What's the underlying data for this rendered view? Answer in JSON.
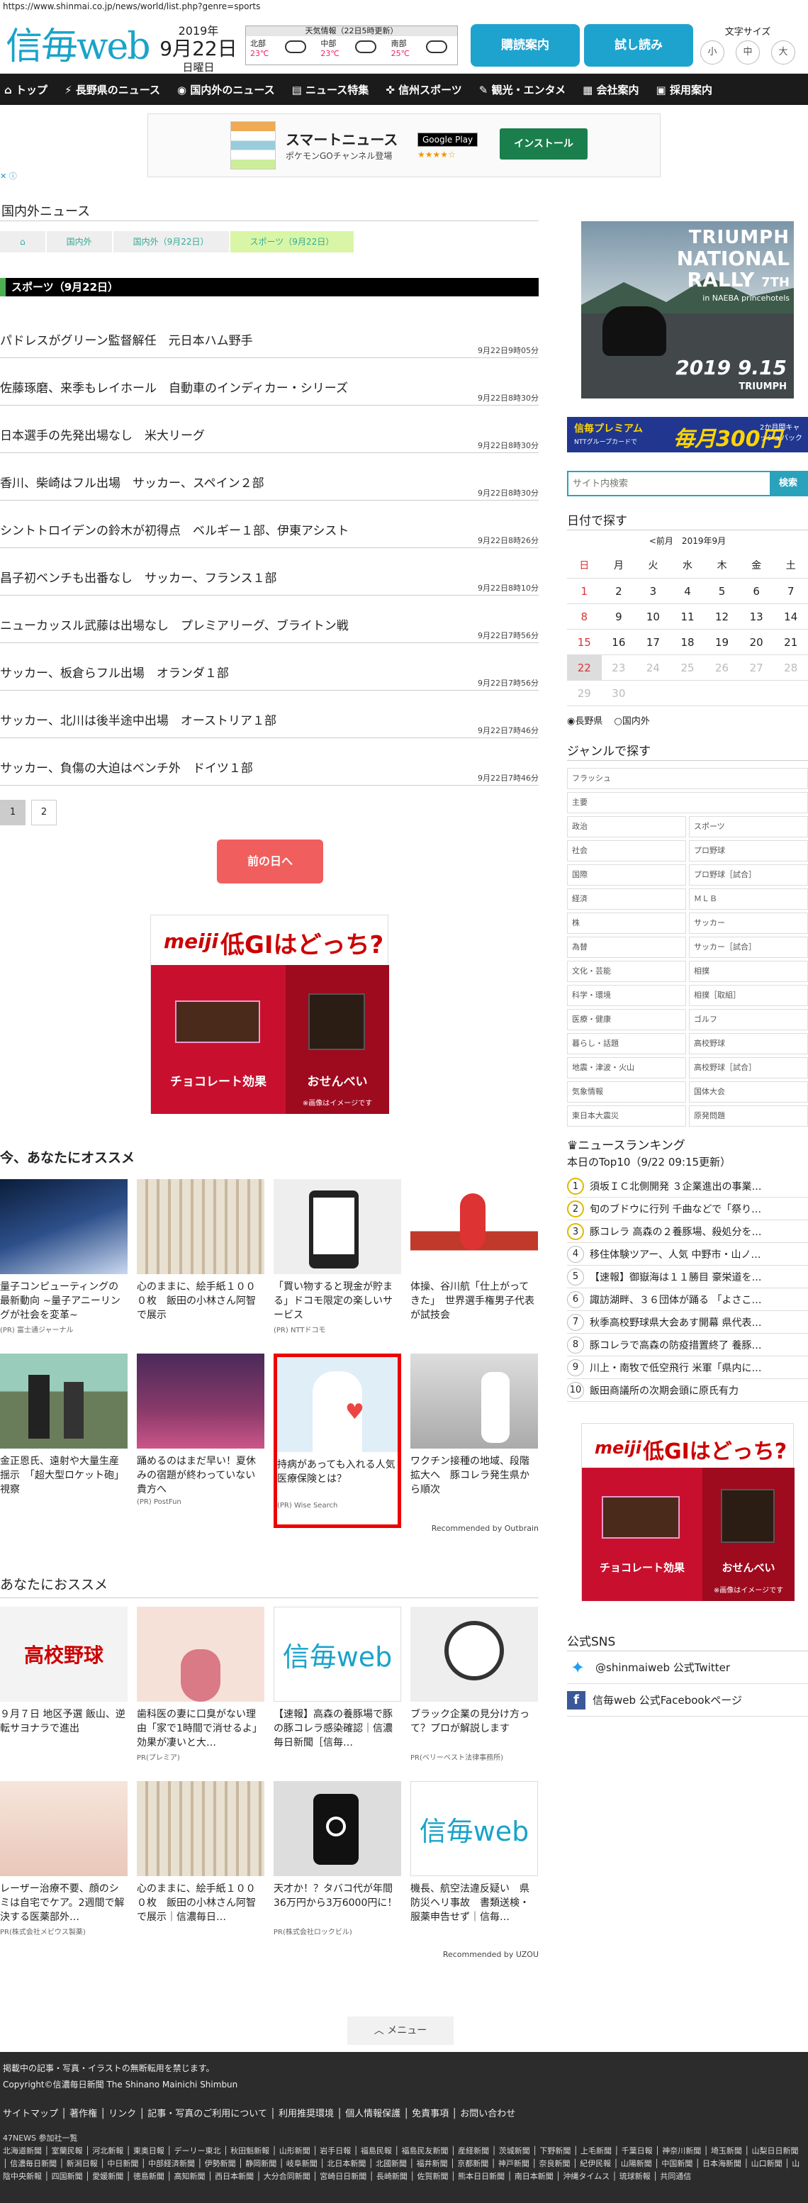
{
  "browser": {
    "url": "https://www.shinmai.co.jp/news/world/list.php?genre=sports"
  },
  "header": {
    "logo": "信毎web",
    "year": "2019年",
    "date": "9月22日",
    "weekday": "日曜日",
    "weather_title": "天気情報（22日5時更新）",
    "weather": [
      {
        "region": "北部",
        "temp": "23℃"
      },
      {
        "region": "中部",
        "temp": "23℃"
      },
      {
        "region": "南部",
        "temp": "25℃"
      }
    ],
    "btn_delivery": "購読案内",
    "btn_trial": "試し読み",
    "font_size_label": "文字サイズ",
    "font_sizes": [
      "小",
      "中",
      "大"
    ]
  },
  "nav": [
    "トップ",
    "長野県のニュース",
    "国内外のニュース",
    "ニュース特集",
    "信州スポーツ",
    "観光・エンタメ",
    "会社案内",
    "採用案内"
  ],
  "top_ad": {
    "name": "スマートニュース",
    "sub": "ポケモンGOチャンネル登場",
    "store": "Google Play",
    "stars": "★★★★☆",
    "cta": "インストール",
    "mark": "✕ ⓘ"
  },
  "main": {
    "section": "国内外ニュース",
    "breadcrumb": [
      "国内外",
      "国内外（9月22日）",
      "スポーツ（9月22日）"
    ],
    "list_title": "スポーツ（9月22日）",
    "news": [
      {
        "title": "パドレスがグリーン監督解任　元日本ハム野手",
        "date": "9月22日9時05分"
      },
      {
        "title": "佐藤琢磨、来季もレイホール　自動車のインディカー・シリーズ",
        "date": "9月22日8時30分"
      },
      {
        "title": "日本選手の先発出場なし　米大リーグ",
        "date": "9月22日8時30分"
      },
      {
        "title": "香川、柴崎はフル出場　サッカー、スペイン２部",
        "date": "9月22日8時30分"
      },
      {
        "title": "シントトロイデンの鈴木が初得点　ベルギー１部、伊東アシスト",
        "date": "9月22日8時26分"
      },
      {
        "title": "昌子初ベンチも出番なし　サッカー、フランス１部",
        "date": "9月22日8時10分"
      },
      {
        "title": "ニューカッスル武藤は出場なし　プレミアリーグ、ブライトン戦",
        "date": "9月22日7時56分"
      },
      {
        "title": "サッカー、板倉らフル出場　オランダ１部",
        "date": "9月22日7時56分"
      },
      {
        "title": "サッカー、北川は後半途中出場　オーストリア１部",
        "date": "9月22日7時46分"
      },
      {
        "title": "サッカー、負傷の大迫はベンチ外　ドイツ１部",
        "date": "9月22日7時46分"
      }
    ],
    "pages": [
      "1",
      "2"
    ],
    "prev_day": "前の日へ"
  },
  "meiji_ad": {
    "brand": "meiji",
    "headline": "低GIはどっち?",
    "left_label": "チョコレート効果",
    "right_label": "おせんべい",
    "note": "※画像はイメージです"
  },
  "recommend1": {
    "title": "今、あなたにオススメ",
    "cards": [
      {
        "text": "量子コンピューティングの最新動向 ~量子アニーリングが社会を変革~",
        "sponsor": "(PR) 富士通ジャーナル"
      },
      {
        "text": "心のままに、絵手紙１０００枚　飯田の小林さん阿智で展示",
        "sponsor": ""
      },
      {
        "text": "「買い物すると現金が貯まる」ドコモ限定の楽しいサービス",
        "sponsor": "(PR) NTTドコモ"
      },
      {
        "text": "体操、谷川航「仕上がってきた」　世界選手権男子代表が試技会",
        "sponsor": ""
      },
      {
        "text": "金正恩氏、遠射や大量生産揺示　「超大型ロケット砲」視察",
        "sponsor": ""
      },
      {
        "text": "踊めるのはまだ早い！夏休みの宿題が終わっていない貴方へ",
        "sponsor": "(PR) PostFun"
      },
      {
        "text": "持病があっても入れる人気医療保険とは？",
        "sponsor": "(PR) Wise Search"
      },
      {
        "text": "ワクチン接種の地域、段階拡大へ　豚コレラ発生県から順次",
        "sponsor": ""
      }
    ],
    "credit": "Recommended by Outbrain"
  },
  "recommend2": {
    "title": "あなたにおススメ",
    "cards": [
      {
        "text": "９月７日 地区予選 飯山、逆転サヨナラで進出",
        "sponsor": "",
        "img_text": "高校野球"
      },
      {
        "text": "歯科医の妻に口臭がない理由「家で1時間で消せるよ」効果が凄いと大…",
        "sponsor": "PR(プレミア)",
        "img_text": ""
      },
      {
        "text": "【速報】高森の養豚場で豚の豚コレラ感染確認｜信濃毎日新聞［信毎…",
        "sponsor": "",
        "img_text": "信毎web"
      },
      {
        "text": "ブラック企業の見分け方って？プロが解説します",
        "sponsor": "PR(ベリーベスト法律事務所)",
        "img_text": ""
      },
      {
        "text": "レーザー治療不要、顔のシミは自宅でケア。2週間で解決する医薬部外…",
        "sponsor": "PR(株式会社メビウス製薬)",
        "img_text": ""
      },
      {
        "text": "心のままに、絵手紙１０００枚　飯田の小林さん阿智で展示｜信濃毎日…",
        "sponsor": "",
        "img_text": ""
      },
      {
        "text": "天才か！？タバコ代が年間36万円から3万6000円に！",
        "sponsor": "PR(株式会社ロックビル)",
        "img_text": ""
      },
      {
        "text": "機長、航空法違反疑い　県防災ヘリ事故　書類送検・服薬申告せず｜信毎…",
        "sponsor": "",
        "img_text": "信毎web"
      }
    ],
    "credit": "Recommended by UZOU"
  },
  "side": {
    "triumph": {
      "brand": "TRIUMPH",
      "l1": "NATIONAL",
      "l2": "RALLY",
      "nth": "7TH",
      "venue": "in NAEBA princehotels",
      "date": "2019 9.15",
      "mark": "TRIUMPH"
    },
    "premium": {
      "a": "信毎プレミアム",
      "b": "NTTグループカードで",
      "c": "毎月300円",
      "e": "2か月間キャッシュバック"
    },
    "search_placeholder": "サイト内検索",
    "search_btn": "検索",
    "cal_title": "日付で探す",
    "cal_nav": "<前月　2019年9月",
    "weekdays": [
      "日",
      "月",
      "火",
      "水",
      "木",
      "金",
      "土"
    ],
    "days": [
      [
        "1",
        "2",
        "3",
        "4",
        "5",
        "6",
        "7"
      ],
      [
        "8",
        "9",
        "10",
        "11",
        "12",
        "13",
        "14"
      ],
      [
        "15",
        "16",
        "17",
        "18",
        "19",
        "20",
        "21"
      ],
      [
        "22",
        "23",
        "24",
        "25",
        "26",
        "27",
        "28"
      ],
      [
        "29",
        "30",
        "",
        "",
        "",
        "",
        ""
      ]
    ],
    "radio": [
      "長野県",
      "国内外"
    ],
    "genre_title": "ジャンルで探す",
    "genres": [
      "フラッシュ",
      "主要",
      "政治",
      "スポーツ",
      "社会",
      "プロ野球",
      "国際",
      "プロ野球［試合］",
      "経済",
      "ＭＬＢ",
      "株",
      "サッカー",
      "為替",
      "サッカー［試合］",
      "文化・芸能",
      "相撲",
      "科学・環境",
      "相撲［取組］",
      "医療・健康",
      "ゴルフ",
      "暮らし・話題",
      "高校野球",
      "地震・津波・火山",
      "高校野球［試合］",
      "気象情報",
      "国体大会",
      "東日本大震災",
      "原発問題"
    ],
    "rank_title": "ニュースランキング",
    "rank_sub": "本日のTop10（9/22 09:15更新）",
    "ranking": [
      "須坂ＩＣ北側開発 ３企業進出の事業…",
      "旬のブドウに行列 千曲などで「祭り…",
      "豚コレラ 高森の２養豚場、殺処分を…",
      "移住体験ツアー、人気 中野市・山ノ…",
      "【速報】御嶽海は１１勝目 豪栄道を…",
      "諏訪湖畔、３６団体が踊る 「よさこ…",
      "秋季高校野球県大会あす開幕 県代表…",
      "豚コレラで高森の防疫措置終了 養豚…",
      "川上・南牧で低空飛行 米軍「県内に…",
      "飯田商議所の次期会頭に原氏有力"
    ],
    "sns_title": "公式SNS",
    "sns": [
      "@shinmaiweb 公式Twitter",
      "信毎web 公式Facebookページ"
    ]
  },
  "footer": {
    "menu": "メニュー",
    "notice": "掲載中の記事・写真・イラストの無断転用を禁じます。",
    "copyright": "Copyright©信濃毎日新聞 The Shinano Mainichi Shimbun",
    "links": "サイトマップ │ 著作権 │ リンク │ 記事・写真のご利用について │ 利用推奨環境 │ 個人情報保護 │ 免責事項 │ お問い合わせ",
    "net_title": "47NEWS 参加社一覧",
    "net": "北海道新聞 │ 室蘭民報 │ 河北新報 │ 東奥日報 │ デーリー東北 │ 秋田魁新報 │ 山形新聞 │ 岩手日報 │ 福島民報 │ 福島民友新聞 │ 産経新聞 │ 茨城新聞 │ 下野新聞 │ 上毛新聞 │ 千葉日報 │ 神奈川新聞 │ 埼玉新聞 │ 山梨日日新聞 │ 信濃毎日新聞 │ 新潟日報 │ 中日新聞 │ 中部経済新聞 │ 伊勢新聞 │ 静岡新聞 │ 岐阜新聞 │ 北日本新聞 │ 北國新聞 │ 福井新聞 │ 京都新聞 │ 神戸新聞 │ 奈良新聞 │ 紀伊民報 │ 山陽新聞 │ 中国新聞 │ 日本海新聞 │ 山口新聞 │ 山陰中央新報 │ 四国新聞 │ 愛媛新聞 │ 徳島新聞 │ 高知新聞 │ 西日本新聞 │ 大分合同新聞 │ 宮崎日日新聞 │ 長崎新聞 │ 佐賀新聞 │ 熊本日日新聞 │ 南日本新聞 │ 沖縄タイムス │ 琉球新報 │ 共同通信"
  }
}
